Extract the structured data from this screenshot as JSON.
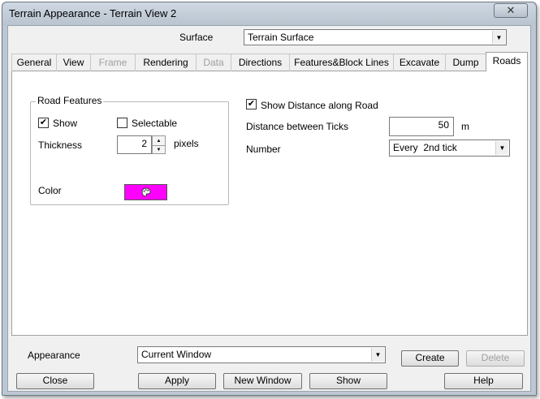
{
  "window": {
    "title": "Terrain Appearance - Terrain View 2",
    "close_glyph": "✕"
  },
  "surface": {
    "label": "Surface",
    "value": "Terrain Surface"
  },
  "tabs": [
    {
      "label": "General",
      "state": "normal"
    },
    {
      "label": "View",
      "state": "normal"
    },
    {
      "label": "Frame",
      "state": "disabled"
    },
    {
      "label": "Rendering",
      "state": "normal"
    },
    {
      "label": "Data",
      "state": "disabled"
    },
    {
      "label": "Directions",
      "state": "normal"
    },
    {
      "label": "Features&Block Lines",
      "state": "normal"
    },
    {
      "label": "Excavate",
      "state": "normal"
    },
    {
      "label": "Dump",
      "state": "normal"
    },
    {
      "label": "Roads",
      "state": "active"
    }
  ],
  "road_features": {
    "group_title": "Road Features",
    "show": {
      "label": "Show",
      "checked": true
    },
    "selectable": {
      "label": "Selectable",
      "checked": false
    },
    "thickness": {
      "label": "Thickness",
      "value": "2",
      "unit": "pixels"
    },
    "color": {
      "label": "Color",
      "swatch": "#ff00ff",
      "icon": "palette-icon"
    }
  },
  "distance": {
    "show_distance": {
      "label": "Show Distance along Road",
      "checked": true
    },
    "ticks": {
      "label": "Distance between Ticks",
      "value": "50",
      "unit": "m"
    },
    "number": {
      "label": "Number",
      "value": "Every  2nd tick"
    }
  },
  "appearance": {
    "label": "Appearance",
    "value": "Current Window"
  },
  "buttons": {
    "create": "Create",
    "delete": "Delete",
    "close": "Close",
    "apply": "Apply",
    "new_window": "New Window",
    "show": "Show",
    "help": "Help"
  },
  "check_glyph": "✔"
}
